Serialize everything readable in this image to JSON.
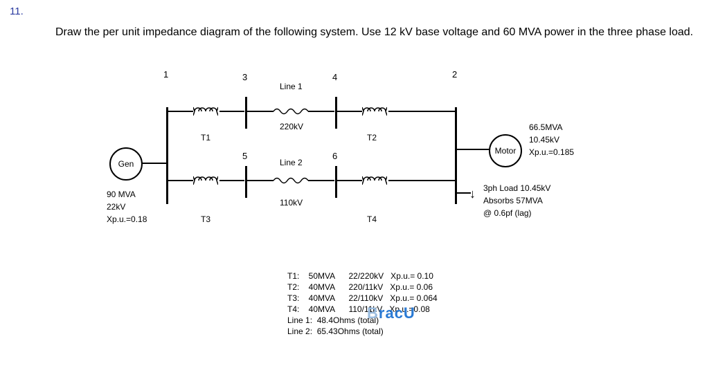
{
  "question": {
    "number": "11.",
    "text": "Draw the per unit impedance diagram of the following system. Use 12 kV base voltage and 60 MVA power  in the three phase load."
  },
  "buses": {
    "b1": "1",
    "b2": "2",
    "b3": "3",
    "b4": "4",
    "b5": "5",
    "b6": "6"
  },
  "lines": {
    "line1_label": "Line 1",
    "line1_kv": "220kV",
    "line2_label": "Line 2",
    "line2_kv": "110kV"
  },
  "gen": {
    "name": "Gen",
    "mva": "90 MVA",
    "kv": "22kV",
    "xpu": "Xp.u.=0.18"
  },
  "motor": {
    "name": "Motor",
    "mva": "66.5MVA",
    "kv": "10.45kV",
    "xpu": "Xp.u.=0.185"
  },
  "load": {
    "l1": "3ph Load  10.45kV",
    "l2": "Absorbs 57MVA",
    "l3": "@ 0.6pf (lag)"
  },
  "xfmr_labels": {
    "t1": "T1",
    "t2": "T2",
    "t3": "T3",
    "t4": "T4"
  },
  "table": {
    "t1": "T1:    50MVA      22/220kV   Xp.u.= 0.10",
    "t2": "T2:    40MVA      220/11kV   Xp.u.= 0.06",
    "t3": "T3:    40MVA      22/110kV   Xp.u.= 0.064",
    "t4": "T4:    40MVA      110/11kV   Xp.u.=0.08",
    "l1": "Line 1:  48.4Ohms (total)",
    "l2": "Line 2:  65.43Ohms (total)"
  },
  "watermark": "racU"
}
